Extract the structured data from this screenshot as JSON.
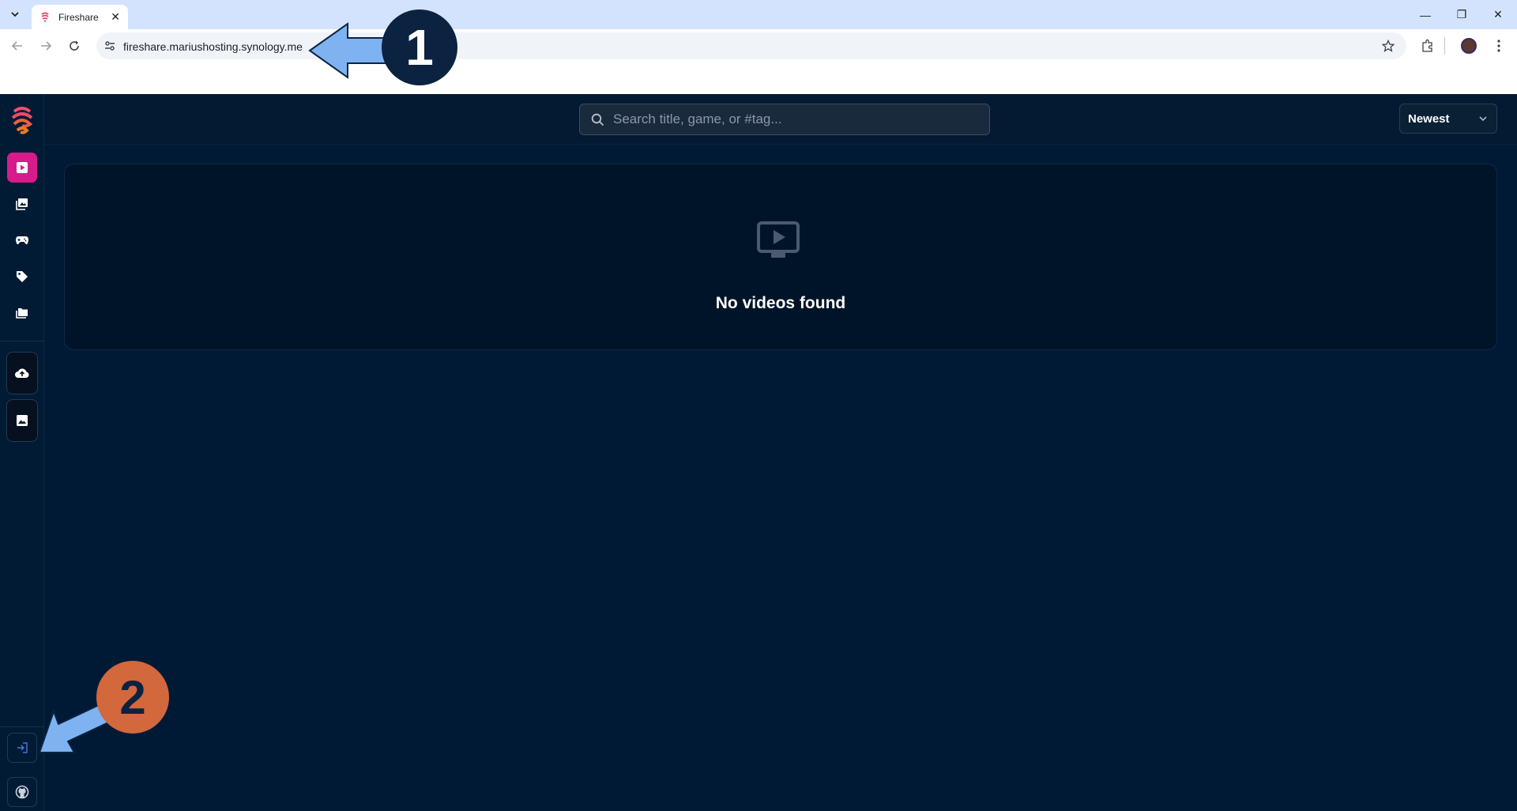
{
  "browser": {
    "tab_title": "Fireshare",
    "url": "fireshare.mariushosting.synology.me"
  },
  "app": {
    "search_placeholder": "Search title, game, or #tag...",
    "sort_label": "Newest",
    "empty_message": "No videos found",
    "sidebar_items": [
      "videos-icon",
      "images-icon",
      "games-icon",
      "tags-icon",
      "folders-icon"
    ],
    "accent_color": "#d81b8a"
  },
  "annotations": {
    "marker_1": "1",
    "marker_2": "2",
    "marker_1_color": "#0b2340",
    "marker_2_color": "#d2683c",
    "arrow_color": "#7fb2f0"
  }
}
